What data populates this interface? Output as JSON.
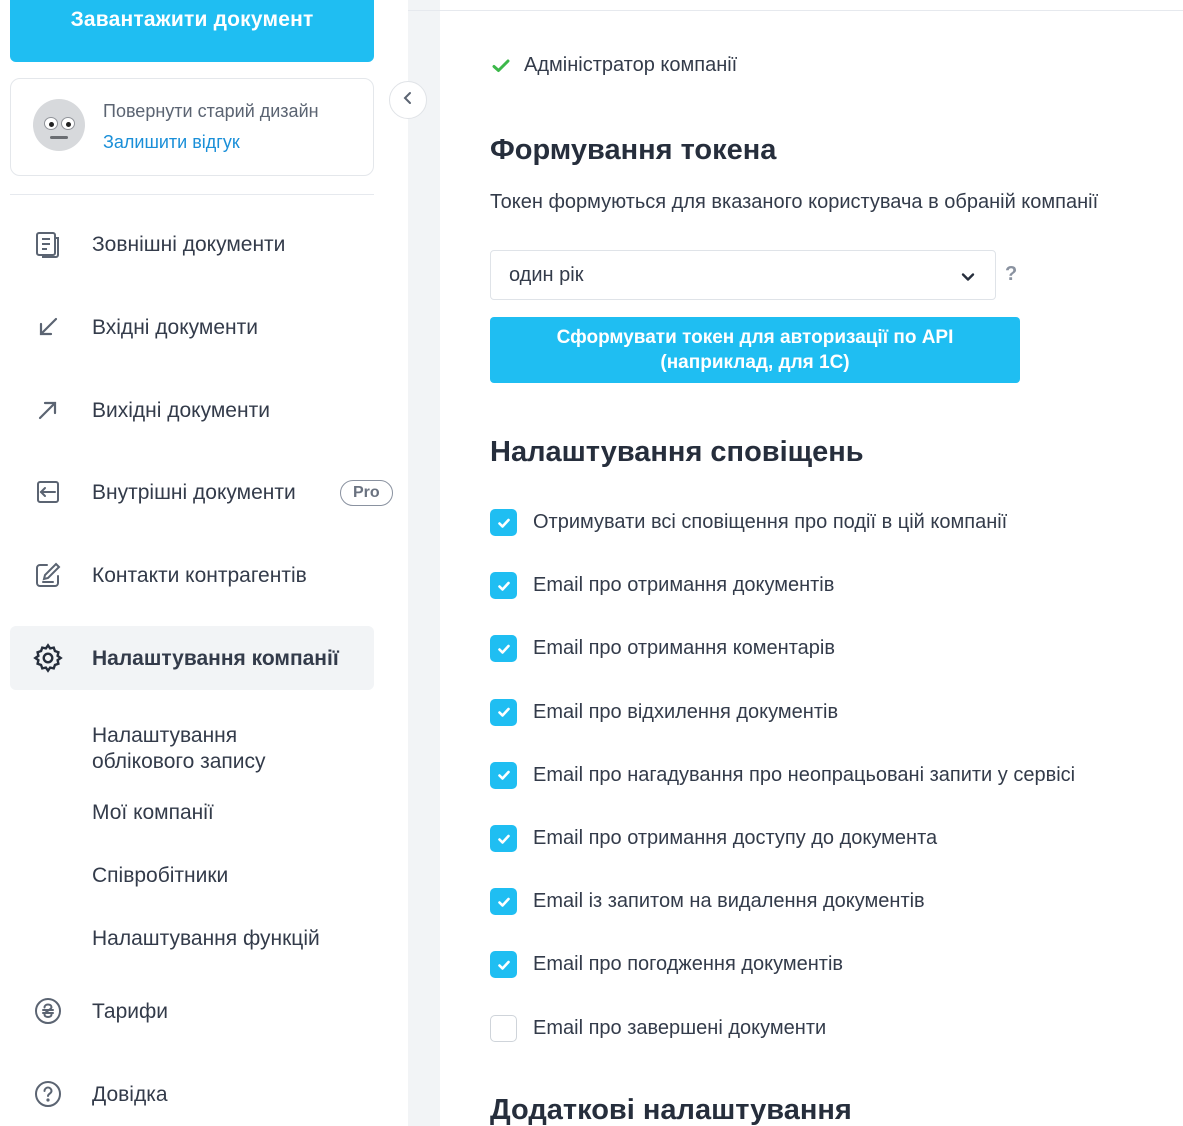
{
  "sidebar": {
    "upload_button": "Завантажити документ",
    "feedback": {
      "old_design": "Повернути старий дизайн",
      "leave_feedback": "Залишити відгук"
    },
    "nav": [
      {
        "label": "Зовнішні документи",
        "icon": "documents-icon"
      },
      {
        "label": "Вхідні документи",
        "icon": "arrow-down-left-icon"
      },
      {
        "label": "Вихідні документи",
        "icon": "arrow-up-right-icon"
      },
      {
        "label": "Внутрішні документи",
        "icon": "internal-docs-icon",
        "badge": "Pro"
      },
      {
        "label": "Контакти контрагентів",
        "icon": "edit-contacts-icon"
      },
      {
        "label": "Налаштування компанії",
        "icon": "gear-icon",
        "active": true
      }
    ],
    "sub_items": [
      "Налаштування облікового запису",
      "Мої компанії",
      "Співробітники",
      "Налаштування функцій"
    ],
    "bottom_nav": [
      {
        "label": "Тарифи",
        "icon": "hryvnia-icon"
      },
      {
        "label": "Довідка",
        "icon": "help-icon"
      }
    ]
  },
  "main": {
    "role": "Адміністратор компанії",
    "token_section": {
      "title": "Формування токена",
      "description": "Токен формуються для вказаного користувача в обраній компанії",
      "select_value": "один рік",
      "help": "?",
      "button_line1": "Сформувати токен для авторизації по API",
      "button_line2": "(наприклад, для 1С)"
    },
    "notifications": {
      "title": "Налаштування сповіщень",
      "items": [
        {
          "label": "Отримувати всі сповіщення про події в цій компанії",
          "checked": true
        },
        {
          "label": "Email про отримання документів",
          "checked": true
        },
        {
          "label": "Email про отримання коментарів",
          "checked": true
        },
        {
          "label": "Email про відхилення документів",
          "checked": true
        },
        {
          "label": "Email про нагадування про неопрацьовані запити у сервісі",
          "checked": true
        },
        {
          "label": "Email про отримання доступу до документа",
          "checked": true
        },
        {
          "label": "Email із запитом на видалення документів",
          "checked": true
        },
        {
          "label": "Email про погодження документів",
          "checked": true
        },
        {
          "label": "Email про завершені документи",
          "checked": false
        }
      ]
    },
    "additional_title": "Додаткові налаштування"
  },
  "colors": {
    "accent": "#1fbef2",
    "link": "#1a8fd8",
    "success": "#3cb84a"
  }
}
